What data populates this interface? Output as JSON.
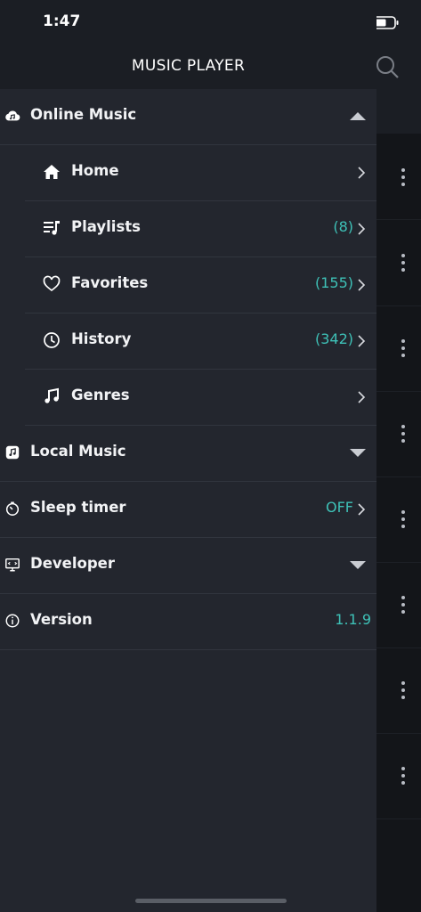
{
  "status_bar": {
    "time": "1:47"
  },
  "header": {
    "title": "MUSIC PLAYER"
  },
  "menu": {
    "online_music": {
      "label": "Online Music",
      "icon": "cloud-music-icon"
    },
    "home": {
      "label": "Home",
      "icon": "home-icon"
    },
    "playlists": {
      "label": "Playlists",
      "count": "(8)",
      "icon": "playlist-icon"
    },
    "favorites": {
      "label": "Favorites",
      "count": "(155)",
      "icon": "heart-icon"
    },
    "history": {
      "label": "History",
      "count": "(342)",
      "icon": "clock-icon"
    },
    "genres": {
      "label": "Genres",
      "icon": "music-note-icon"
    },
    "local_music": {
      "label": "Local Music",
      "icon": "local-music-icon"
    },
    "sleep_timer": {
      "label": "Sleep timer",
      "value": "OFF",
      "icon": "timer-icon"
    },
    "developer": {
      "label": "Developer",
      "icon": "monitor-icon"
    },
    "version": {
      "label": "Version",
      "value": "1.1.9",
      "icon": "info-icon"
    }
  },
  "colors": {
    "accent": "#3ec1b7",
    "drawer_bg": "#23262e",
    "header_bg": "#1b1e24"
  }
}
